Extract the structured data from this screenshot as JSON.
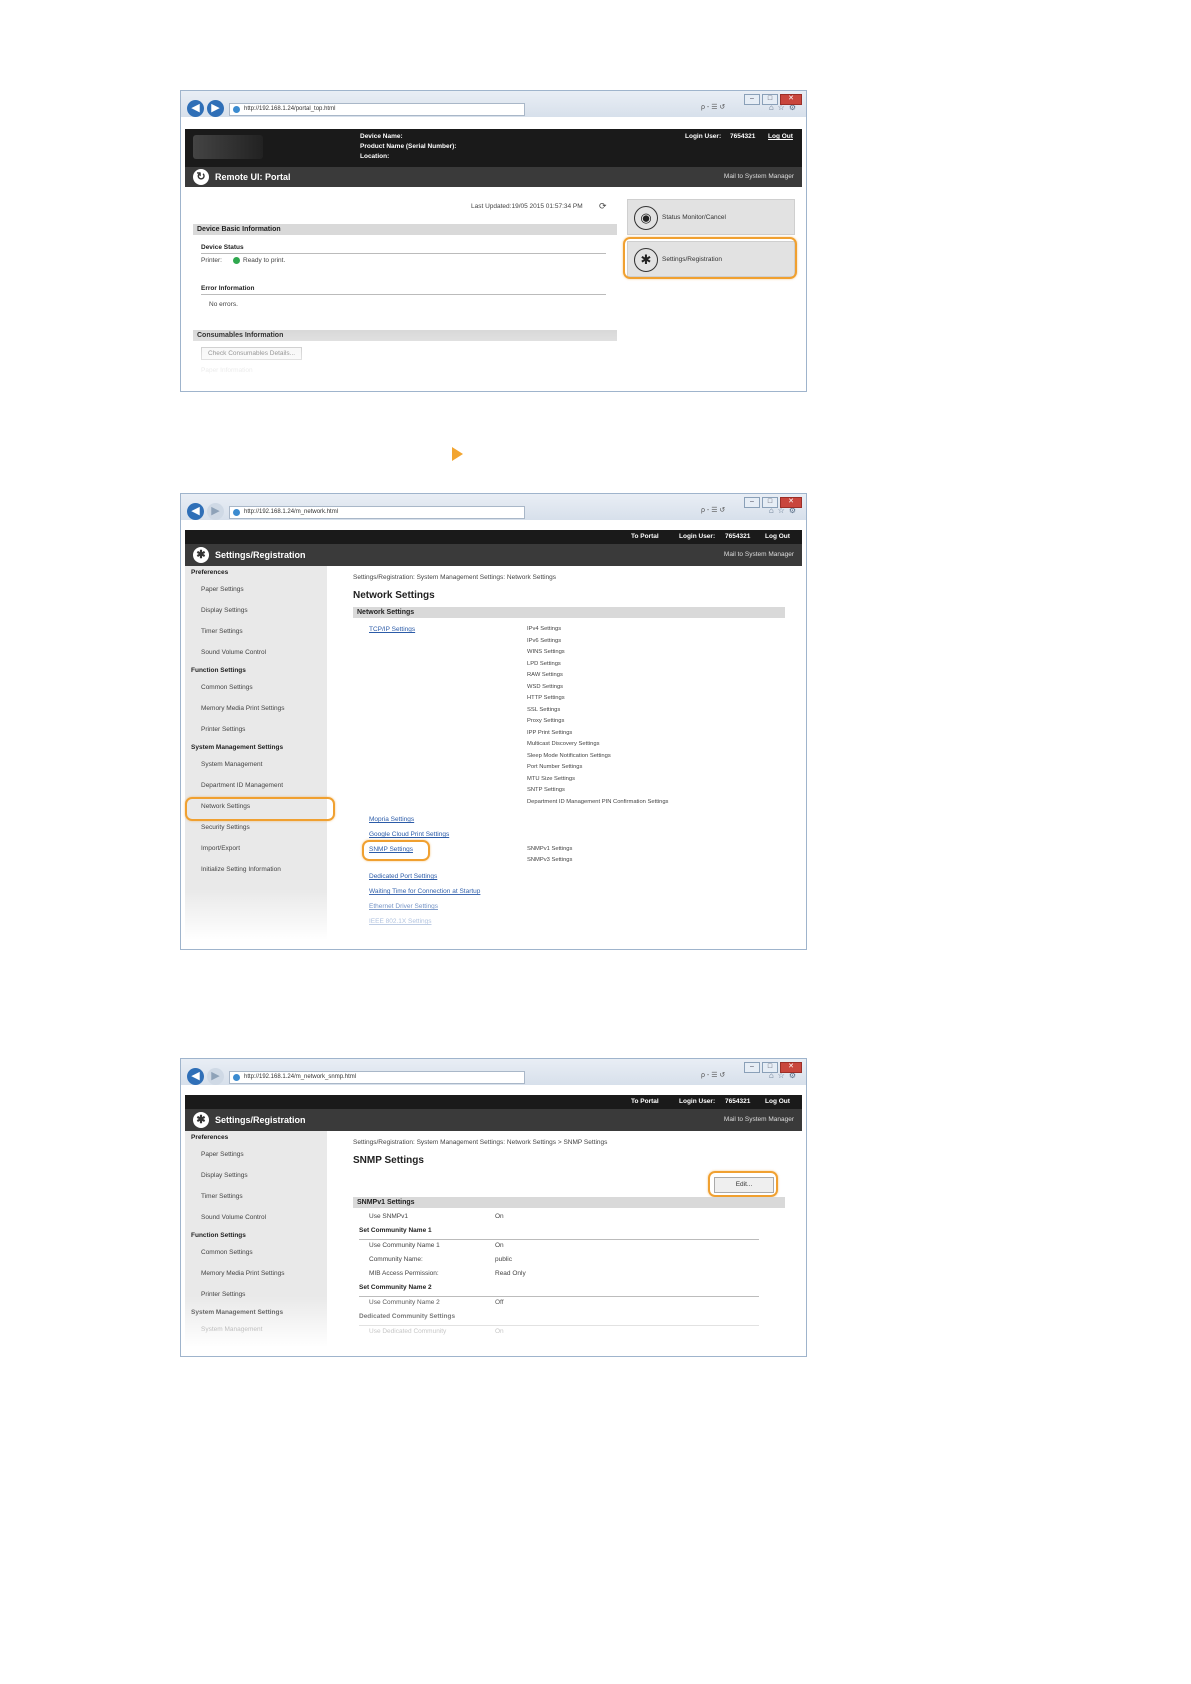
{
  "shot1": {
    "address": "http://192.168.1.24/portal_top.html",
    "search_icons": "ρ - ☰ ↺",
    "header": {
      "device_name_label": "Device Name:",
      "product_name_label": "Product Name (Serial Number):",
      "location_label": "Location:",
      "login_user_label": "Login User:",
      "login_user_value": "7654321",
      "logout": "Log Out"
    },
    "title": "Remote UI: Portal",
    "mail": "Mail to System Manager",
    "last_updated": "Last Updated:19/05 2015 01:57:34 PM",
    "device_basic_info": "Device Basic Information",
    "device_status": "Device Status",
    "printer_label": "Printer:",
    "printer_status": "Ready to print.",
    "error_info": "Error Information",
    "no_errors": "No errors.",
    "consumables_info": "Consumables Information",
    "check_consumables": "Check Consumables Details...",
    "paper_info": "Paper Information",
    "status_monitor": "Status Monitor/Cancel",
    "settings_registration": "Settings/Registration"
  },
  "shot2": {
    "address": "http://192.168.1.24/m_network.html",
    "to_portal": "To Portal",
    "login_user_label": "Login User:",
    "login_user_value": "7654321",
    "logout": "Log Out",
    "title": "Settings/Registration",
    "mail": "Mail to System Manager",
    "breadcrumb": "Settings/Registration: System Management Settings: Network Settings",
    "page_title": "Network Settings",
    "section": "Network Settings",
    "tcpip": "TCP/IP Settings",
    "tcpip_subs": [
      "IPv4 Settings",
      "IPv6 Settings",
      "WINS Settings",
      "LPD Settings",
      "RAW Settings",
      "WSD Settings",
      "HTTP Settings",
      "SSL Settings",
      "Proxy Settings",
      "IPP Print Settings",
      "Multicast Discovery Settings",
      "Sleep Mode Notification Settings",
      "Port Number Settings",
      "MTU Size Settings",
      "SNTP Settings",
      "Department ID Management PIN Confirmation Settings"
    ],
    "mopria": "Mopria Settings",
    "google_cloud": "Google Cloud Print Settings",
    "snmp": "SNMP Settings",
    "snmp_subs": [
      "SNMPv1 Settings",
      "SNMPv3 Settings"
    ],
    "dedicated_port": "Dedicated Port Settings",
    "waiting_time": "Waiting Time for Connection at Startup",
    "ethernet_driver": "Ethernet Driver Settings",
    "ieee": "IEEE 802.1X Settings"
  },
  "shot3": {
    "address": "http://192.168.1.24/m_network_snmp.html",
    "to_portal": "To Portal",
    "login_user_label": "Login User:",
    "login_user_value": "7654321",
    "logout": "Log Out",
    "title": "Settings/Registration",
    "mail": "Mail to System Manager",
    "breadcrumb": "Settings/Registration: System Management Settings: Network Settings > SNMP Settings",
    "page_title": "SNMP Settings",
    "edit": "Edit...",
    "snmpv1_section": "SNMPv1 Settings",
    "rows": [
      {
        "label": "Use SNMPv1",
        "value": "On",
        "indent": 1
      },
      {
        "label": "Set Community Name 1",
        "value": "",
        "indent": 0
      },
      {
        "label": "Use Community Name 1",
        "value": "On",
        "indent": 1
      },
      {
        "label": "Community Name:",
        "value": "public",
        "indent": 1
      },
      {
        "label": "MIB Access Permission:",
        "value": "Read Only",
        "indent": 1
      },
      {
        "label": "Set Community Name 2",
        "value": "",
        "indent": 0
      },
      {
        "label": "Use Community Name 2",
        "value": "Off",
        "indent": 1
      },
      {
        "label": "Dedicated Community Settings",
        "value": "",
        "indent": 0
      },
      {
        "label": "Use Dedicated Community",
        "value": "On",
        "indent": 1
      }
    ]
  },
  "sidebar": {
    "preferences": "Preferences",
    "paper": "Paper Settings",
    "display": "Display Settings",
    "timer": "Timer Settings",
    "sound": "Sound Volume Control",
    "function": "Function Settings",
    "common": "Common Settings",
    "memory": "Memory Media Print Settings",
    "printer": "Printer Settings",
    "system": "System Management Settings",
    "system_mgmt": "System Management",
    "department": "Department ID Management",
    "network": "Network Settings",
    "security": "Security Settings",
    "import_export": "Import/Export",
    "initialize": "Initialize Setting Information"
  }
}
